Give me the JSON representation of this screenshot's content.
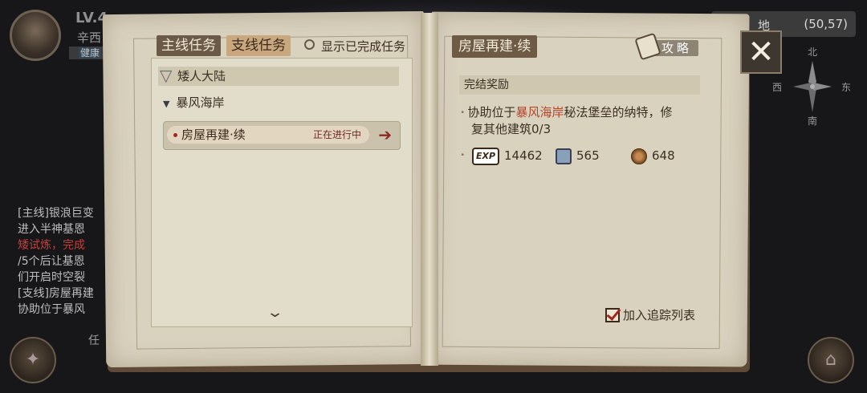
{
  "hud": {
    "level": "LV.4",
    "player_name": "辛西",
    "status_text": "健康",
    "side_log": [
      {
        "text": "[主线]银浪巨变",
        "class": ""
      },
      {
        "text": "进入半神基恩",
        "class": ""
      },
      {
        "text": "矮试炼，完成",
        "class": "red"
      },
      {
        "text": "/5个后让基恩",
        "class": ""
      },
      {
        "text": "们开启时空裂",
        "class": ""
      },
      {
        "text": "[支线]房屋再建",
        "class": ""
      },
      {
        "text": "协助位于暴风",
        "class": ""
      }
    ],
    "map_label": "地",
    "coordinates": "(50,57)",
    "compass": {
      "north": "北",
      "south": "南",
      "east": "东",
      "west": "西"
    },
    "bottom_right_label": "任"
  },
  "left_page": {
    "tabs": [
      {
        "label": "主线任务",
        "active": false
      },
      {
        "label": "支线任务",
        "active": true
      }
    ],
    "show_completed_label": "显示已完成任务",
    "region": "矮人大陆",
    "subregion": "暴风海岸",
    "quests": [
      {
        "name": "房屋再建·续",
        "state": "正在进行中"
      }
    ]
  },
  "right_page": {
    "quest_title": "房屋再建·续",
    "guide_label": "攻略",
    "reward_header": "完结奖励",
    "description_pre": "协助位于",
    "description_highlight": "暴风海岸",
    "description_post": "秘法堡垒的纳特，修",
    "description_line2": "复其他建筑0/3",
    "rewards": [
      {
        "icon": "exp-icon",
        "value": "14462"
      },
      {
        "icon": "skill-book-icon",
        "value": "565"
      },
      {
        "icon": "coin-icon",
        "value": "648"
      }
    ],
    "track_label": "加入追踪列表"
  },
  "colors": {
    "highlight": "#b4452b",
    "accent_red": "#a0261f"
  }
}
